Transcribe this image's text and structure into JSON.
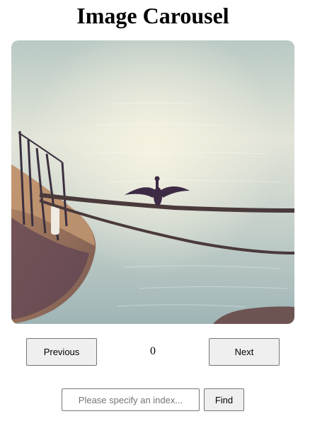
{
  "page": {
    "title": "Image Carousel"
  },
  "carousel": {
    "image_alt": "Cormorant with spread wings perched on a mooring rope beside an old boat on calm water",
    "current_index": "0"
  },
  "controls": {
    "previous_label": "Previous",
    "next_label": "Next"
  },
  "search": {
    "placeholder": "Please specify an index...",
    "value": "",
    "find_label": "Find"
  }
}
